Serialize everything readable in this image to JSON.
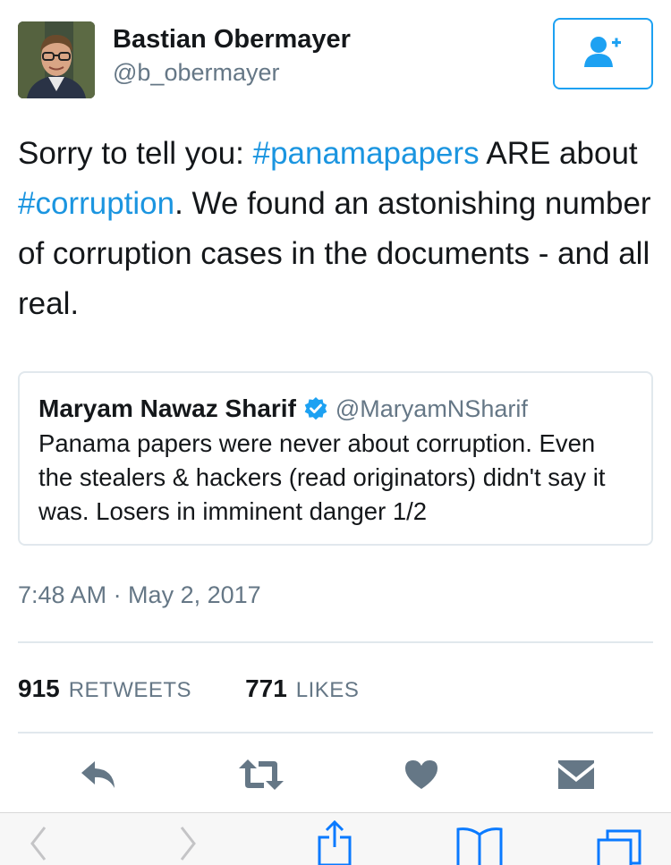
{
  "author": {
    "name": "Bastian Obermayer",
    "handle": "@b_obermayer"
  },
  "tweet": {
    "segments": [
      {
        "text": "Sorry to tell you: ",
        "type": "text"
      },
      {
        "text": "#panamapapers",
        "type": "hashtag"
      },
      {
        "text": " ARE about ",
        "type": "text"
      },
      {
        "text": "#corruption",
        "type": "hashtag"
      },
      {
        "text": ". We found an astonishing number of corruption cases in the documents - and all real.",
        "type": "text"
      }
    ]
  },
  "quoted": {
    "name": "Maryam Nawaz Sharif",
    "handle": "@MaryamNSharif",
    "text": "Panama papers were never about corruption. Even the stealers & hackers (read originators) didn't say it was. Losers in imminent danger 1/2"
  },
  "timestamp": "7:48 AM · May 2, 2017",
  "stats": {
    "retweets_count": "915",
    "retweets_label": "RETWEETS",
    "likes_count": "771",
    "likes_label": "LIKES"
  },
  "icons": {
    "follow": "add-user-icon",
    "verified": "verified-badge-icon",
    "reply": "reply-icon",
    "retweet": "retweet-icon",
    "like": "heart-icon",
    "dm": "envelope-icon",
    "back": "chevron-left-icon",
    "forward": "chevron-right-icon",
    "share": "share-icon",
    "bookmarks": "book-icon",
    "tabs": "tabs-icon"
  },
  "colors": {
    "accent": "#1da1f2",
    "hashtag": "#1b95e0",
    "text": "#14171a",
    "secondary": "#657786",
    "action_icon": "#657786",
    "safari_blue": "#0a7aff",
    "disabled": "#c4c4c6"
  }
}
